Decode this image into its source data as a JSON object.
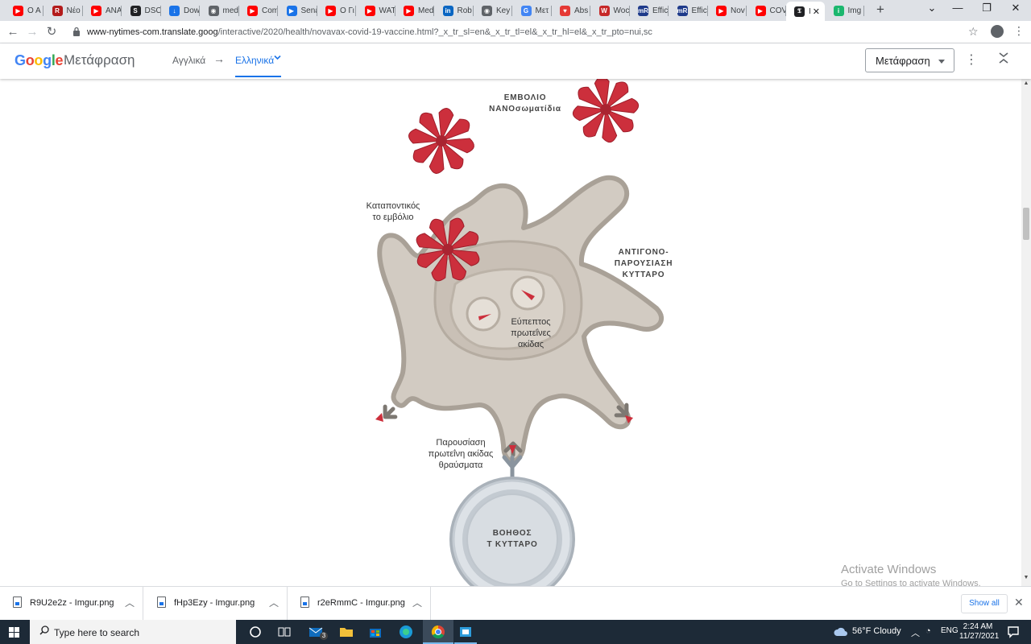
{
  "browser": {
    "tabs": [
      {
        "label": "O A",
        "color": "#ff0000",
        "glyph": "▶"
      },
      {
        "label": "Νέο",
        "color": "#b31b1b",
        "glyph": "R"
      },
      {
        "label": "ANA",
        "color": "#ff0000",
        "glyph": "▶"
      },
      {
        "label": "DSC",
        "color": "#202124",
        "glyph": "S"
      },
      {
        "label": "Dow",
        "color": "#1a73e8",
        "glyph": "↓"
      },
      {
        "label": "med",
        "color": "#5f6368",
        "glyph": "◉"
      },
      {
        "label": "Com",
        "color": "#ff0000",
        "glyph": "▶"
      },
      {
        "label": "Sena",
        "color": "#1a73e8",
        "glyph": "▶"
      },
      {
        "label": "O Γι",
        "color": "#ff0000",
        "glyph": "▶"
      },
      {
        "label": "WAT",
        "color": "#ff0000",
        "glyph": "▶"
      },
      {
        "label": "Med",
        "color": "#ff0000",
        "glyph": "▶"
      },
      {
        "label": "Rob",
        "color": "#0a66c2",
        "glyph": "in"
      },
      {
        "label": "Key",
        "color": "#5f6368",
        "glyph": "◉"
      },
      {
        "label": "Μετ",
        "color": "#4285f4",
        "glyph": "G"
      },
      {
        "label": "Abs",
        "color": "#e53935",
        "glyph": "♥"
      },
      {
        "label": "Woc",
        "color": "#c62828",
        "glyph": "W"
      },
      {
        "label": "Effic",
        "color": "#1e3a8a",
        "glyph": "mR"
      },
      {
        "label": "Effic",
        "color": "#1e3a8a",
        "glyph": "mR"
      },
      {
        "label": "Nov",
        "color": "#ff0000",
        "glyph": "▶"
      },
      {
        "label": "COV",
        "color": "#ff0000",
        "glyph": "▶"
      },
      {
        "label": "I",
        "color": "#202124",
        "glyph": "𝕿",
        "active": true
      },
      {
        "label": "Img",
        "color": "#1bb76e",
        "glyph": "i"
      }
    ],
    "new_tab": "+",
    "url_host": "www-nytimes-com.translate.goog",
    "url_path": "/interactive/2020/health/novavax-covid-19-vaccine.html?_x_tr_sl=en&_x_tr_tl=el&_x_tr_hl=el&_x_tr_pto=nui,sc"
  },
  "translate_bar": {
    "logo_google": "Google",
    "title": "Μετάφραση",
    "source_language": "Αγγλικά",
    "arrow": "→",
    "target_language": "Ελληνικά",
    "translate_button": "Μετάφραση"
  },
  "diagram": {
    "label_vaccine": "ΕΜΒΟΛΙΟ\nΝΑΝΟσωματίδια",
    "label_engulf": "Καταποντικός\nτο εμβόλιο",
    "label_apc": "ΑΝΤΙΓΟΝΟ-\nΠΑΡΟΥΣΙΑΣΗ\nΚΥΤΤΑΡΟ",
    "label_digest": "Εύπεπτος\nπρωτεΐνες ακίδας",
    "label_present": "Παρουσίαση\nπρωτεΐνη ακίδας\nθραύσματα",
    "label_helper": "ΒΟΗΘΟΣ\nΤ ΚΥΤΤΑΡΟ",
    "colors": {
      "spike": "#cc2f3c",
      "cell": "#d3ccc4",
      "tcell": "#c8ced4"
    }
  },
  "watermark": {
    "line1": "Activate Windows",
    "line2": "Go to Settings to activate Windows."
  },
  "downloads": {
    "items": [
      "R9U2e2z - Imgur.png",
      "fHp3Ezy - Imgur.png",
      "r2eRmmC - Imgur.png"
    ],
    "show_all": "Show all"
  },
  "taskbar": {
    "search_placeholder": "Type here to search",
    "mail_badge": "3",
    "weather": "56°F  Cloudy",
    "language": "ENG",
    "time": "2:24 AM",
    "date": "11/27/2021"
  }
}
